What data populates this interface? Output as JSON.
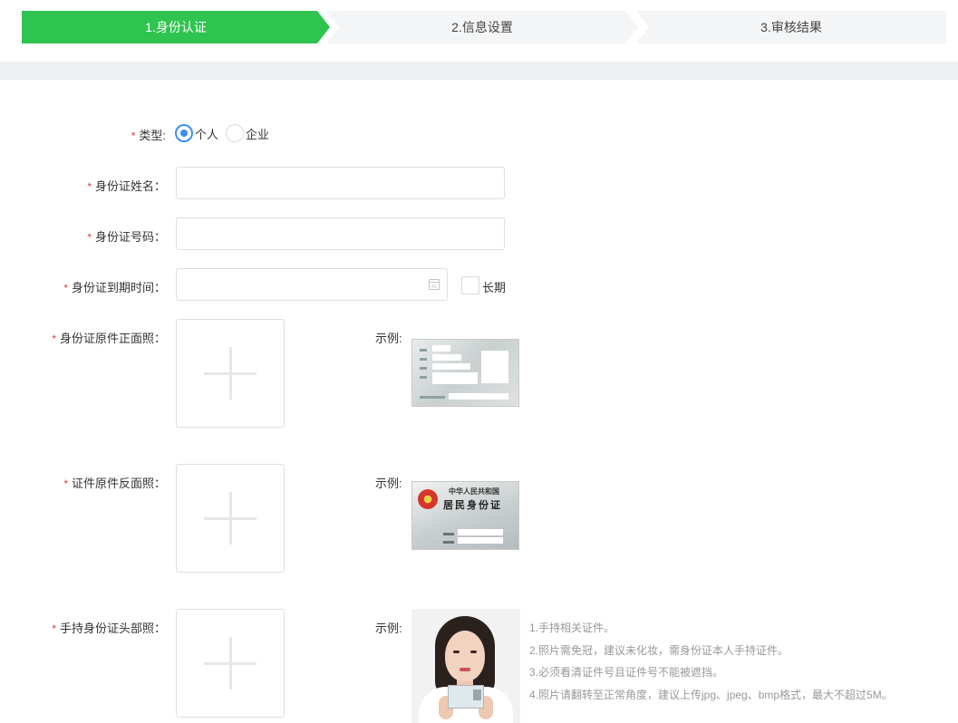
{
  "steps": [
    {
      "label": "1.身份认证",
      "active": true
    },
    {
      "label": "2.信息设置",
      "active": false
    },
    {
      "label": "3.审核结果",
      "active": false
    }
  ],
  "colors": {
    "active_step": "#2fc44f",
    "inactive_step": "#f4f5f6",
    "radio_checked": "#3b8ff5",
    "required": "#e03b3b"
  },
  "form": {
    "required_mark": "*",
    "type": {
      "label": "类型:",
      "options": [
        "个人",
        "企业"
      ],
      "selected": "个人"
    },
    "id_name": {
      "label": "身份证姓名：",
      "value": "",
      "placeholder": ""
    },
    "id_number": {
      "label": "身份证号码：",
      "value": "",
      "placeholder": ""
    },
    "id_expiry": {
      "label": "身份证到期时间：",
      "value": "",
      "long_term_label": "长期",
      "long_term_checked": false
    },
    "front_photo": {
      "label": "身份证原件正面照："
    },
    "back_photo": {
      "label": "证件原件反面照："
    },
    "handheld_photo": {
      "label": "手持身份证头部照："
    },
    "example_label": "示例:"
  },
  "id_back_example": {
    "line1": "中华人民共和国",
    "line2": "居民身份证"
  },
  "tips": [
    "1.手持相关证件。",
    "2.照片需免冠，建议未化妆，需身份证本人手持证件。",
    "3.必须看清证件号且证件号不能被遮挡。",
    "4.照片请翻转至正常角度，建议上传jpg、jpeg、bmp格式，最大不超过5M。"
  ]
}
